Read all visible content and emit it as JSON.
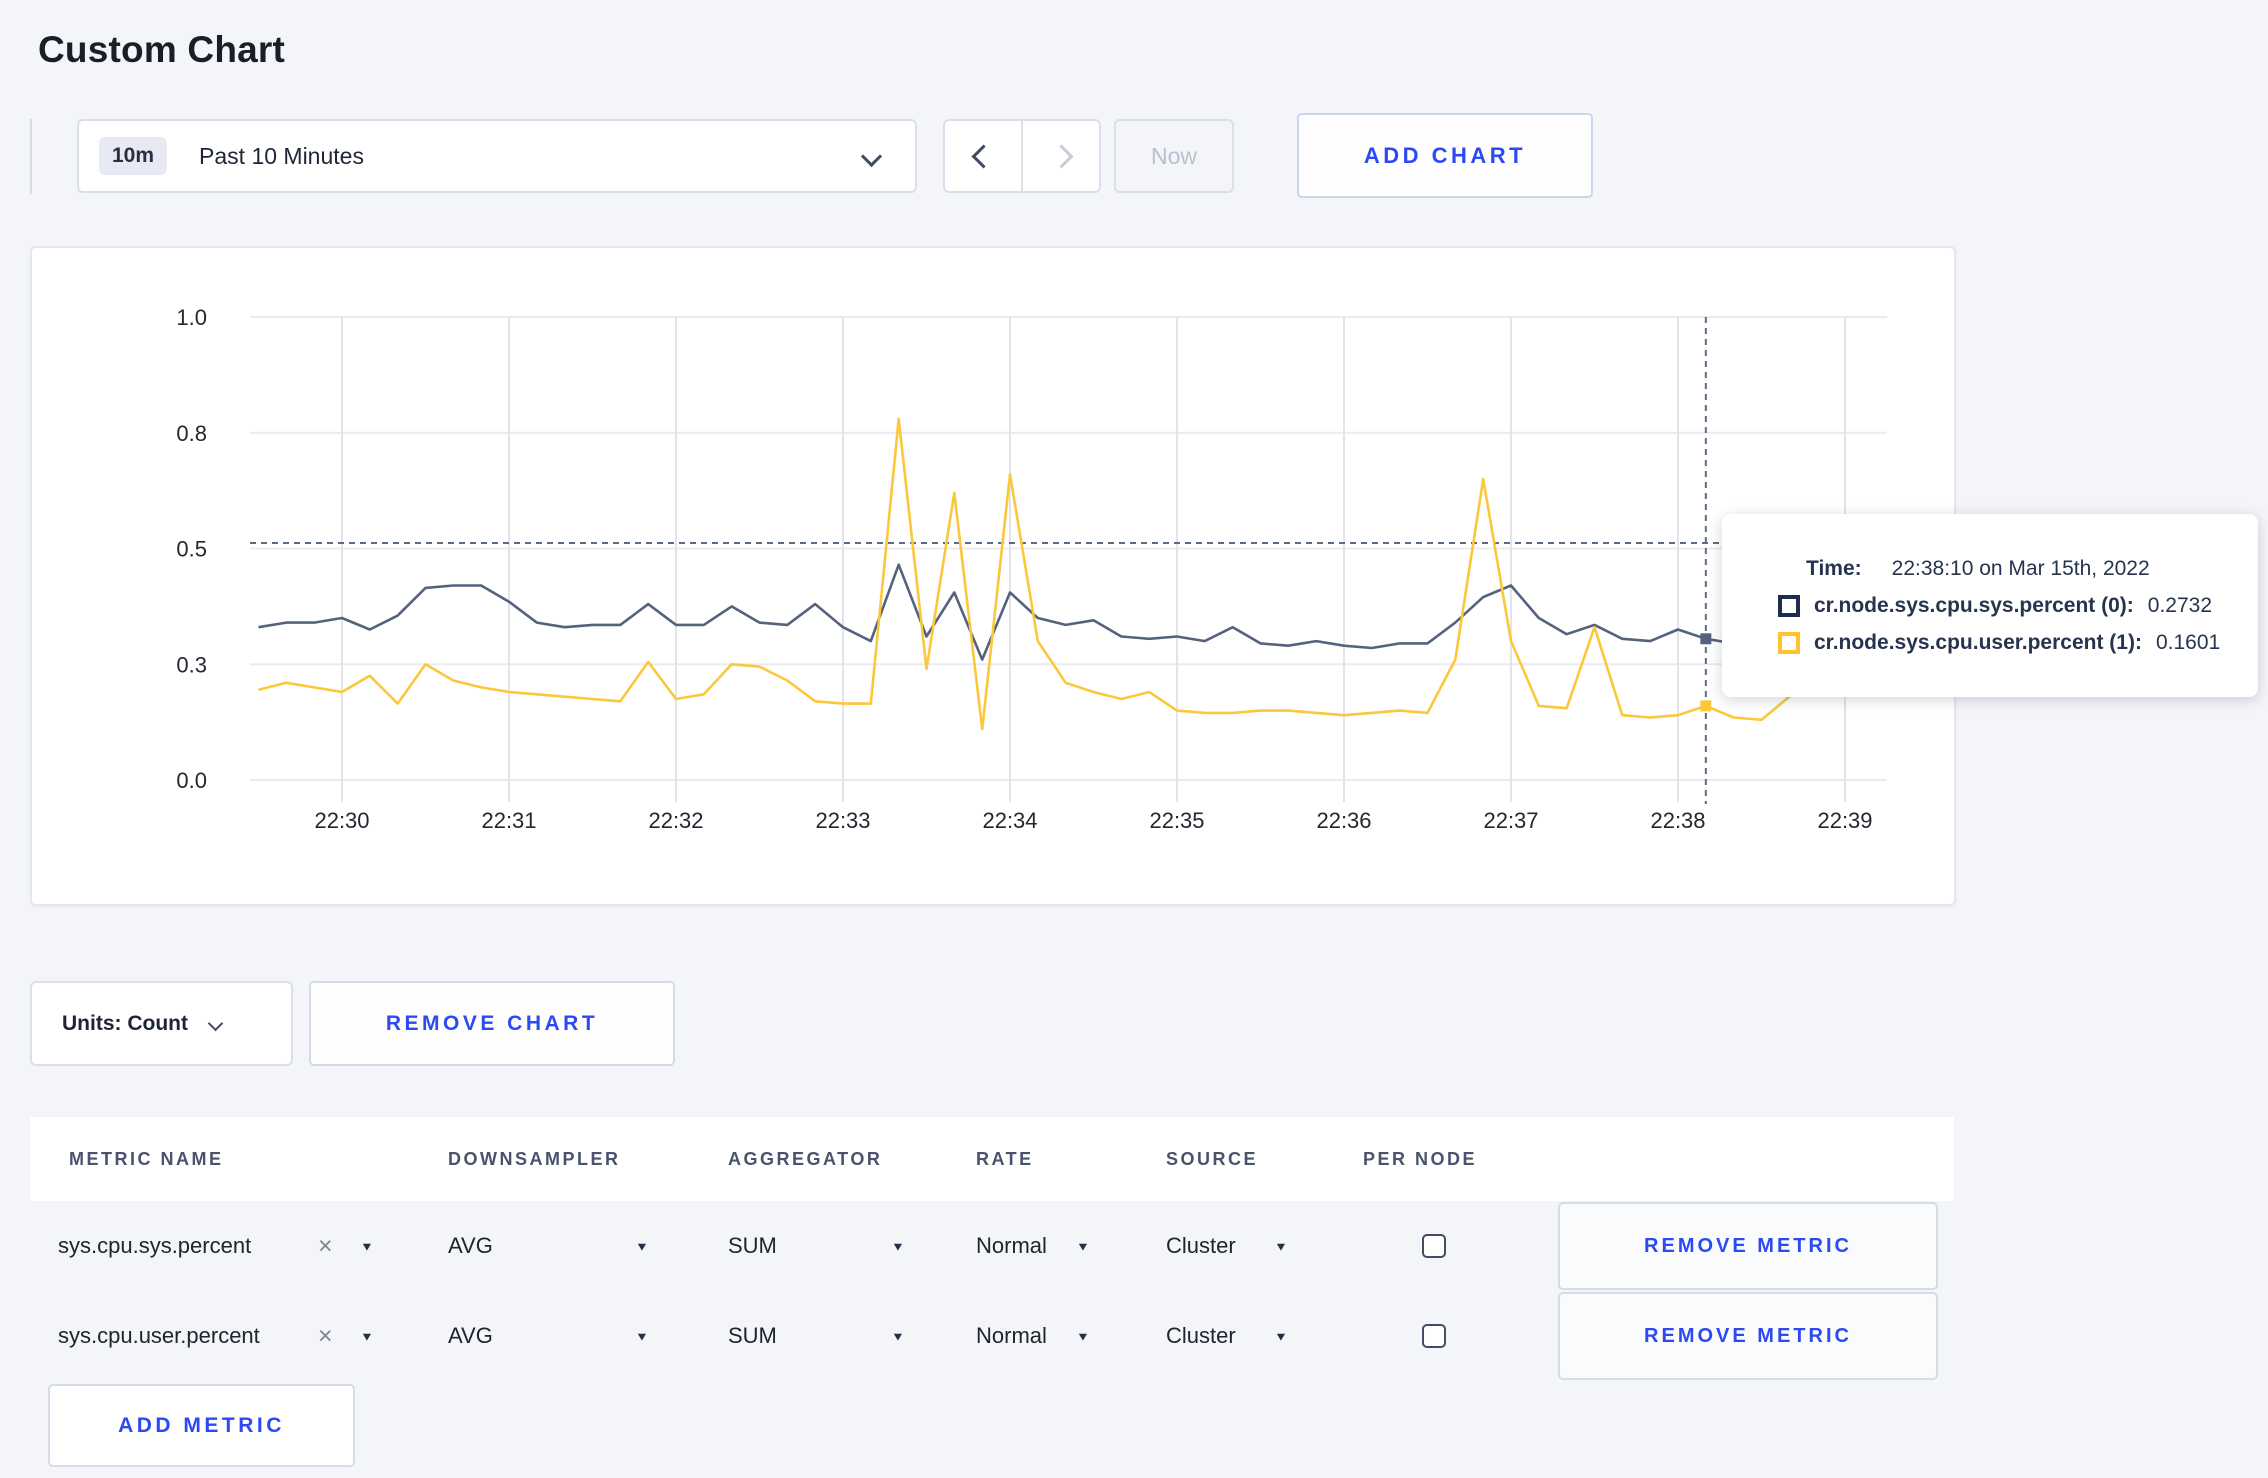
{
  "page": {
    "title": "Custom Chart"
  },
  "toolbar": {
    "time_window_badge": "10m",
    "time_window_label": "Past 10 Minutes",
    "now_label": "Now",
    "add_chart_label": "ADD CHART"
  },
  "chart_data": {
    "type": "line",
    "title": "",
    "xlabel": "",
    "ylabel": "",
    "ylim": [
      0,
      1
    ],
    "grid": true,
    "x_ticks": [
      "22:30",
      "22:31",
      "22:32",
      "22:33",
      "22:34",
      "22:35",
      "22:36",
      "22:37",
      "22:38",
      "22:39"
    ],
    "y_ticks": [
      {
        "label": "1.0",
        "value": 1.0
      },
      {
        "label": "0.8",
        "value": 0.75
      },
      {
        "label": "0.5",
        "value": 0.5
      },
      {
        "label": "0.3",
        "value": 0.25
      },
      {
        "label": "0.0",
        "value": 0.0
      }
    ],
    "start_time": "22:29:30",
    "interval_seconds": 10,
    "series": [
      {
        "name": "cr.node.sys.cpu.sys.percent (0)",
        "color": "#55627e",
        "values": [
          0.33,
          0.34,
          0.34,
          0.35,
          0.325,
          0.355,
          0.415,
          0.42,
          0.42,
          0.385,
          0.34,
          0.33,
          0.335,
          0.335,
          0.38,
          0.335,
          0.335,
          0.375,
          0.34,
          0.335,
          0.38,
          0.33,
          0.3,
          0.465,
          0.31,
          0.405,
          0.26,
          0.405,
          0.35,
          0.335,
          0.345,
          0.31,
          0.305,
          0.31,
          0.3,
          0.33,
          0.295,
          0.29,
          0.3,
          0.29,
          0.285,
          0.295,
          0.295,
          0.34,
          0.395,
          0.42,
          0.35,
          0.315,
          0.335,
          0.305,
          0.3,
          0.325,
          0.305,
          0.295,
          0.3,
          0.32,
          0.31,
          0.295,
          0.31
        ]
      },
      {
        "name": "cr.node.sys.cpu.user.percent (1)",
        "color": "#fbc83b",
        "values": [
          0.195,
          0.21,
          0.2,
          0.19,
          0.225,
          0.165,
          0.25,
          0.215,
          0.2,
          0.19,
          0.185,
          0.18,
          0.175,
          0.17,
          0.255,
          0.175,
          0.185,
          0.25,
          0.245,
          0.215,
          0.17,
          0.165,
          0.165,
          0.78,
          0.24,
          0.62,
          0.11,
          0.66,
          0.3,
          0.21,
          0.19,
          0.175,
          0.19,
          0.15,
          0.145,
          0.145,
          0.15,
          0.15,
          0.145,
          0.14,
          0.145,
          0.15,
          0.145,
          0.26,
          0.65,
          0.3,
          0.16,
          0.155,
          0.33,
          0.14,
          0.135,
          0.14,
          0.1601,
          0.135,
          0.13,
          0.18,
          0.3,
          0.24,
          0.19
        ]
      }
    ],
    "crosshair": {
      "time": "22:38:10",
      "y_value": 0.512
    },
    "legend_position": "tooltip"
  },
  "tooltip": {
    "time_label": "Time:",
    "time_value": "22:38:10 on Mar 15th, 2022",
    "series": [
      {
        "name": "cr.node.sys.cpu.sys.percent (0):",
        "value": "0.2732",
        "color": "#1c2d4f"
      },
      {
        "name": "cr.node.sys.cpu.user.percent (1):",
        "value": "0.1601",
        "color": "#fec32d"
      }
    ]
  },
  "controls": {
    "units_label": "Units: Count",
    "remove_chart_label": "REMOVE CHART",
    "add_metric_label": "ADD METRIC"
  },
  "metrics_table": {
    "headers": [
      "METRIC NAME",
      "DOWNSAMPLER",
      "AGGREGATOR",
      "RATE",
      "SOURCE",
      "PER NODE"
    ],
    "remove_metric_label": "REMOVE METRIC",
    "rows": [
      {
        "metric_name": "sys.cpu.sys.percent",
        "downsampler": "AVG",
        "aggregator": "SUM",
        "rate": "Normal",
        "source": "Cluster",
        "per_node_checked": false
      },
      {
        "metric_name": "sys.cpu.user.percent",
        "downsampler": "AVG",
        "aggregator": "SUM",
        "rate": "Normal",
        "source": "Cluster",
        "per_node_checked": false
      }
    ]
  },
  "icons": {
    "remove_x": "×",
    "dropdown_caret": "▼"
  }
}
